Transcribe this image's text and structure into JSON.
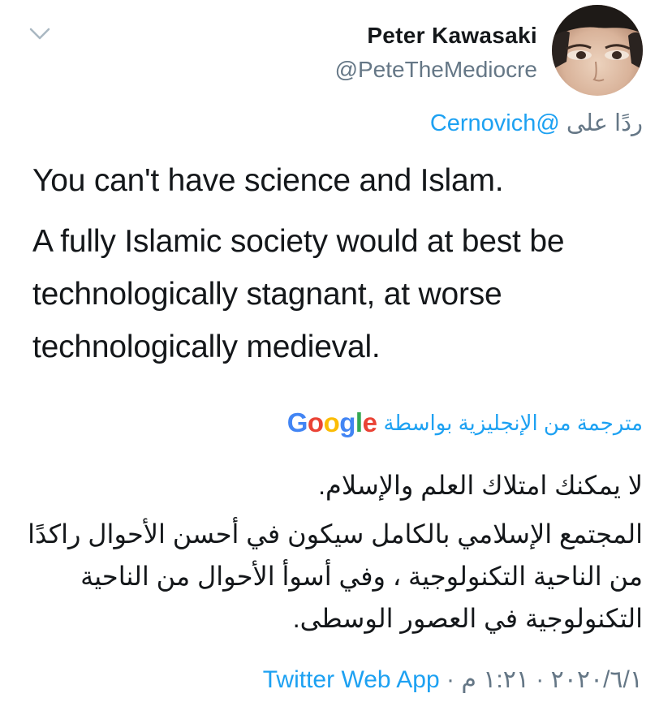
{
  "author": {
    "name": "Peter Kawasaki",
    "handle": "@PeteTheMediocre"
  },
  "reply": {
    "prefix": "ردًا على",
    "mention": "@Cernovich"
  },
  "tweet": {
    "paragraphs": [
      "You can't have science and Islam.",
      "A fully Islamic society would at best be technologically stagnant, at worse technologically medieval."
    ]
  },
  "translation": {
    "label": "مترجمة من الإنجليزية بواسطة",
    "provider": "Google",
    "paragraphs": [
      "لا يمكنك امتلاك العلم والإسلام.",
      "المجتمع الإسلامي بالكامل سيكون في أحسن الأحوال راكدًا من الناحية التكنولوجية ، وفي أسوأ الأحوال من الناحية التكنولوجية في العصور الوسطى."
    ]
  },
  "meta": {
    "date": "٢٠٢٠/٦/١",
    "time": "١:٢١ م",
    "separator": "·",
    "source": "Twitter Web App"
  },
  "colors": {
    "accent": "#1da1f2",
    "secondary_text": "#657786",
    "primary_text": "#14171a"
  },
  "icons": {
    "menu": "chevron-down-icon",
    "avatar": "avatar"
  }
}
